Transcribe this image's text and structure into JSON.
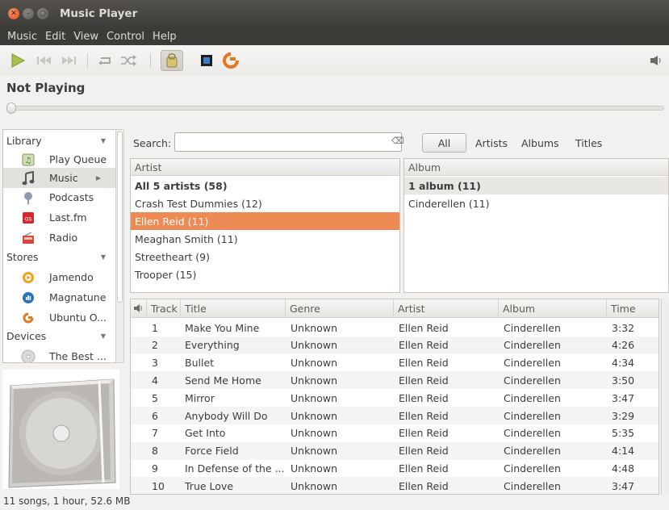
{
  "window": {
    "title": "Music Player"
  },
  "menu": [
    "Music",
    "Edit",
    "View",
    "Control",
    "Help"
  ],
  "toolbar": {
    "buttons": [
      "play-icon",
      "previous-icon",
      "next-icon",
      "repeat-icon",
      "shuffle-icon",
      "browse-icon",
      "visualization-icon",
      "jamendo-icon",
      "volume-icon"
    ]
  },
  "now_playing": {
    "label": "Not Playing",
    "position": 0
  },
  "sidebar": {
    "sections": [
      {
        "label": "Library",
        "items": [
          "Play Queue",
          "Music",
          "Podcasts",
          "Last.fm",
          "Radio"
        ]
      },
      {
        "label": "Stores",
        "items": [
          "Jamendo",
          "Magnatune",
          "Ubuntu O..."
        ]
      },
      {
        "label": "Devices",
        "items": [
          "The Best ..."
        ]
      }
    ],
    "selected": "Music"
  },
  "browser": {
    "search_label": "Search:",
    "search_value": "",
    "filters": [
      "All",
      "Artists",
      "Albums",
      "Titles"
    ],
    "artist_header": "Artist",
    "artists": [
      "All 5 artists (58)",
      "Crash Test Dummies (12)",
      "Ellen Reid (11)",
      "Meaghan Smith (11)",
      "Streetheart (9)",
      "Trooper (15)"
    ],
    "selected_artist": "Ellen Reid (11)",
    "album_header": "Album",
    "albums": [
      "1 album (11)",
      "Cinderellen (11)"
    ]
  },
  "tracks": {
    "columns": [
      "Track",
      "Title",
      "Genre",
      "Artist",
      "Album",
      "Time"
    ],
    "rows": [
      [
        "1",
        "Make You Mine",
        "Unknown",
        "Ellen Reid",
        "Cinderellen",
        "3:32"
      ],
      [
        "2",
        "Everything",
        "Unknown",
        "Ellen Reid",
        "Cinderellen",
        "4:26"
      ],
      [
        "3",
        "Bullet",
        "Unknown",
        "Ellen Reid",
        "Cinderellen",
        "4:34"
      ],
      [
        "4",
        "Send Me Home",
        "Unknown",
        "Ellen Reid",
        "Cinderellen",
        "3:50"
      ],
      [
        "5",
        "Mirror",
        "Unknown",
        "Ellen Reid",
        "Cinderellen",
        "3:47"
      ],
      [
        "6",
        "Anybody Will Do",
        "Unknown",
        "Ellen Reid",
        "Cinderellen",
        "3:29"
      ],
      [
        "7",
        "Get Into",
        "Unknown",
        "Ellen Reid",
        "Cinderellen",
        "5:35"
      ],
      [
        "8",
        "Force Field",
        "Unknown",
        "Ellen Reid",
        "Cinderellen",
        "4:14"
      ],
      [
        "9",
        "In Defense of the ...",
        "Unknown",
        "Ellen Reid",
        "Cinderellen",
        "4:48"
      ],
      [
        "10",
        "True Love",
        "Unknown",
        "Ellen Reid",
        "Cinderellen",
        "3:47"
      ]
    ]
  },
  "status": "11 songs, 1 hour, 52.6 MB",
  "colors": {
    "selection": "#ee8a54",
    "titlebar": "#3c3b37",
    "close": "#df4a16"
  }
}
